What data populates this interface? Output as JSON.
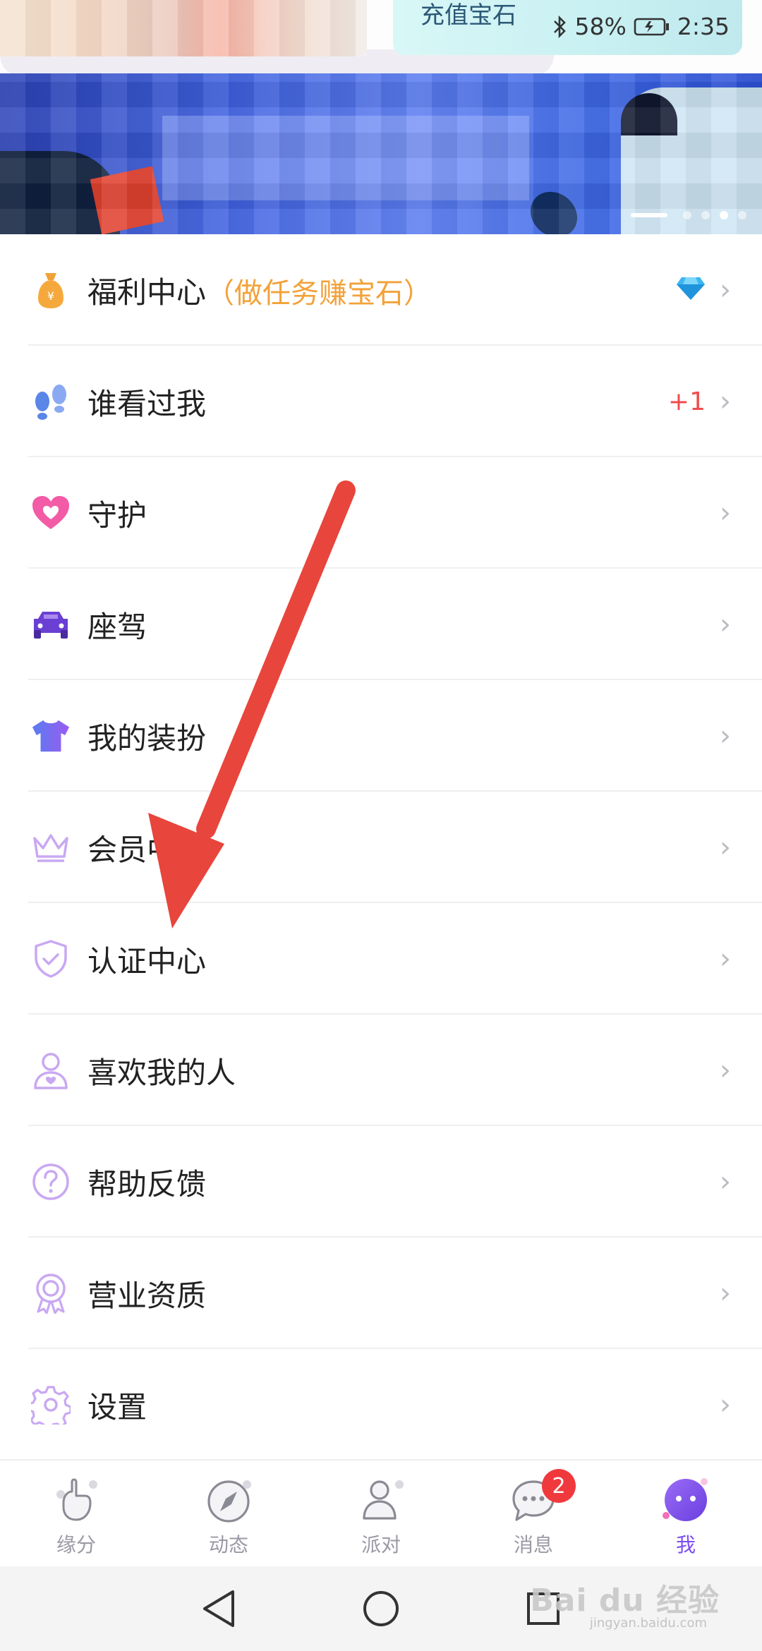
{
  "header": {
    "recharge_label": "充值宝石",
    "status": {
      "battery_percent": "58%",
      "time": "2:35"
    }
  },
  "banner": {
    "dots_total": 4,
    "dots_active": 3
  },
  "menu": {
    "items": [
      {
        "label": "福利中心",
        "sub": "（做任务赚宝石）",
        "icon": "money-bag-icon",
        "right_icon": "diamond-icon"
      },
      {
        "label": "谁看过我",
        "icon": "footprints-icon",
        "extra": "+1"
      },
      {
        "label": "守护",
        "icon": "heart-icon"
      },
      {
        "label": "座驾",
        "icon": "car-icon"
      },
      {
        "label": "我的装扮",
        "icon": "shirt-icon"
      },
      {
        "label": "会员中心",
        "icon": "crown-icon"
      },
      {
        "label": "认证中心",
        "icon": "shield-check-icon"
      },
      {
        "label": "喜欢我的人",
        "icon": "person-heart-icon"
      },
      {
        "label": "帮助反馈",
        "icon": "question-icon"
      },
      {
        "label": "营业资质",
        "icon": "award-icon"
      },
      {
        "label": "设置",
        "icon": "gear-icon"
      }
    ],
    "chevron": "›"
  },
  "tabbar": {
    "tabs": [
      {
        "label": "缘分",
        "icon": "hand-icon"
      },
      {
        "label": "动态",
        "icon": "compass-icon"
      },
      {
        "label": "派对",
        "icon": "people-icon"
      },
      {
        "label": "消息",
        "icon": "chat-icon",
        "badge": "2"
      },
      {
        "label": "我",
        "icon": "me-icon",
        "active": true
      }
    ]
  },
  "watermark": {
    "text": "Bai du 经验",
    "sub": "jingyan.baidu.com"
  },
  "colors": {
    "accent": "#7b4ef0",
    "orange": "#f2a23a",
    "red_badge": "#f0393d",
    "arrow": "#e8453c"
  }
}
